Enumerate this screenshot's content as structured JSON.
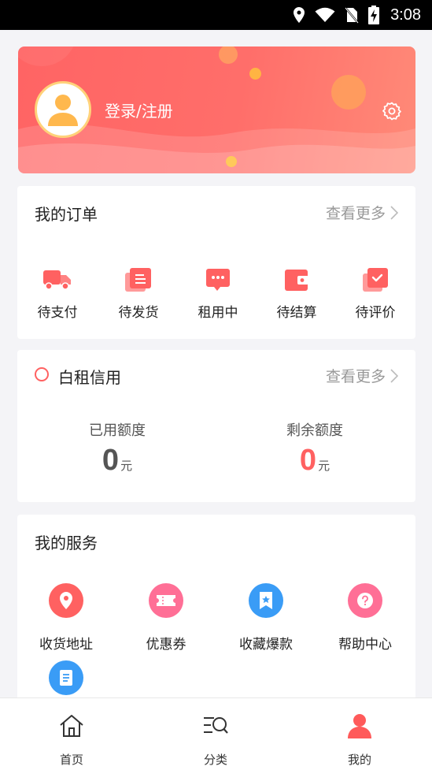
{
  "status_bar": {
    "time": "3:08"
  },
  "profile": {
    "login_label": "登录/注册"
  },
  "orders": {
    "title": "我的订单",
    "more_label": "查看更多",
    "items": [
      {
        "label": "待支付",
        "icon": "truck-icon"
      },
      {
        "label": "待发货",
        "icon": "document-stack-icon"
      },
      {
        "label": "租用中",
        "icon": "chat-bubble-icon"
      },
      {
        "label": "待结算",
        "icon": "wallet-icon"
      },
      {
        "label": "待评价",
        "icon": "check-stack-icon"
      }
    ]
  },
  "credit": {
    "title": "白租信用",
    "more_label": "查看更多",
    "used_label": "已用额度",
    "used_value": "0",
    "remaining_label": "剩余额度",
    "remaining_value": "0",
    "unit": "元",
    "colors": {
      "used": "#555555",
      "remaining": "#ff6161"
    }
  },
  "services": {
    "title": "我的服务",
    "items": [
      {
        "label": "收货地址",
        "icon": "location-pin-icon",
        "color": "#ff6161"
      },
      {
        "label": "优惠券",
        "icon": "ticket-icon",
        "color": "#ff6f96"
      },
      {
        "label": "收藏爆款",
        "icon": "bookmark-star-icon",
        "color": "#3a9cf6"
      },
      {
        "label": "帮助中心",
        "icon": "help-icon",
        "color": "#ff6f96"
      },
      {
        "label": "",
        "icon": "document-icon",
        "color": "#3a9cf6"
      }
    ]
  },
  "bottom_nav": {
    "items": [
      {
        "label": "首页",
        "icon": "home-icon"
      },
      {
        "label": "分类",
        "icon": "category-search-icon"
      },
      {
        "label": "我的",
        "icon": "user-icon"
      }
    ]
  },
  "colors": {
    "accent": "#ff6161",
    "header_gradient": [
      "#ff6464",
      "#ff8a78"
    ]
  }
}
